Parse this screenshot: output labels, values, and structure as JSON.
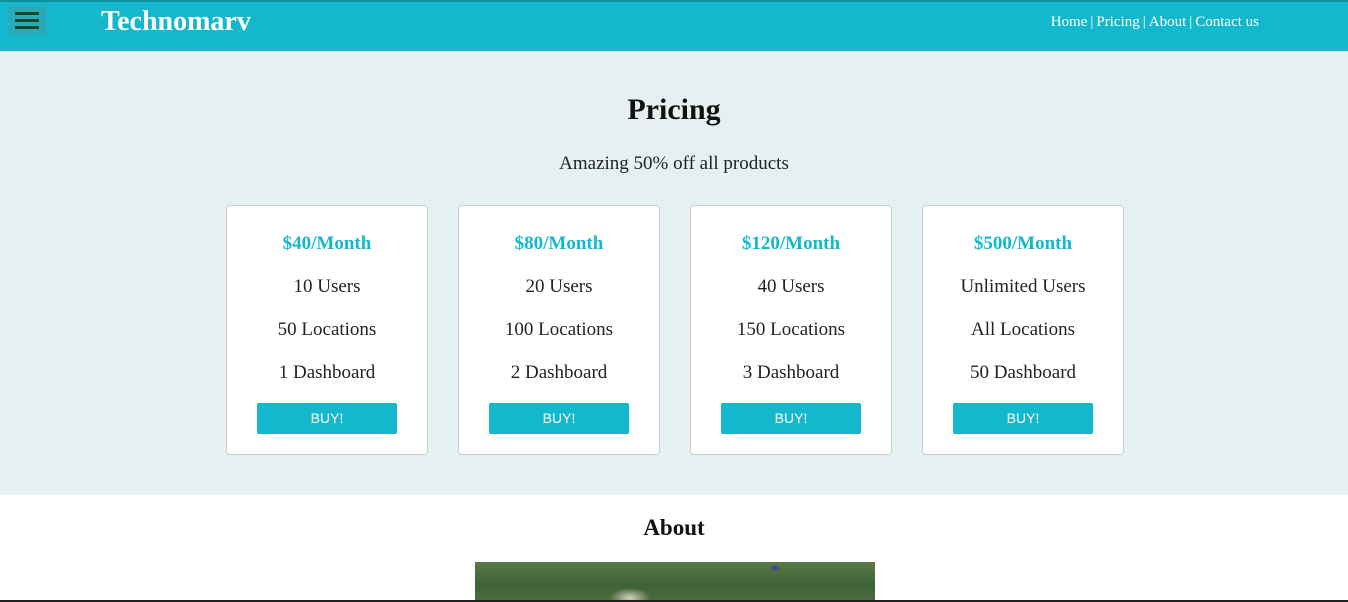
{
  "header": {
    "brand": "Technomarv",
    "menu_icon": "hamburger-menu-icon",
    "nav": [
      "Home",
      "Pricing",
      "About",
      "Contact us"
    ],
    "nav_separator": "|",
    "background_color": "#13b8cc"
  },
  "pricing": {
    "title": "Pricing",
    "subtitle": "Amazing 50% off all products",
    "background_color": "#e5f1f1",
    "plans": [
      {
        "price": "$40/Month",
        "users": "10 Users",
        "locations": "50 Locations",
        "dashboards": "1 Dashboard",
        "button": "BUY!"
      },
      {
        "price": "$80/Month",
        "users": "20 Users",
        "locations": "100 Locations",
        "dashboards": "2 Dashboard",
        "button": "BUY!"
      },
      {
        "price": "$120/Month",
        "users": "40 Users",
        "locations": "150 Locations",
        "dashboards": "3 Dashboard",
        "button": "BUY!"
      },
      {
        "price": "$500/Month",
        "users": "Unlimited Users",
        "locations": "All Locations",
        "dashboards": "50 Dashboard",
        "button": "BUY!"
      }
    ]
  },
  "about": {
    "title": "About"
  }
}
